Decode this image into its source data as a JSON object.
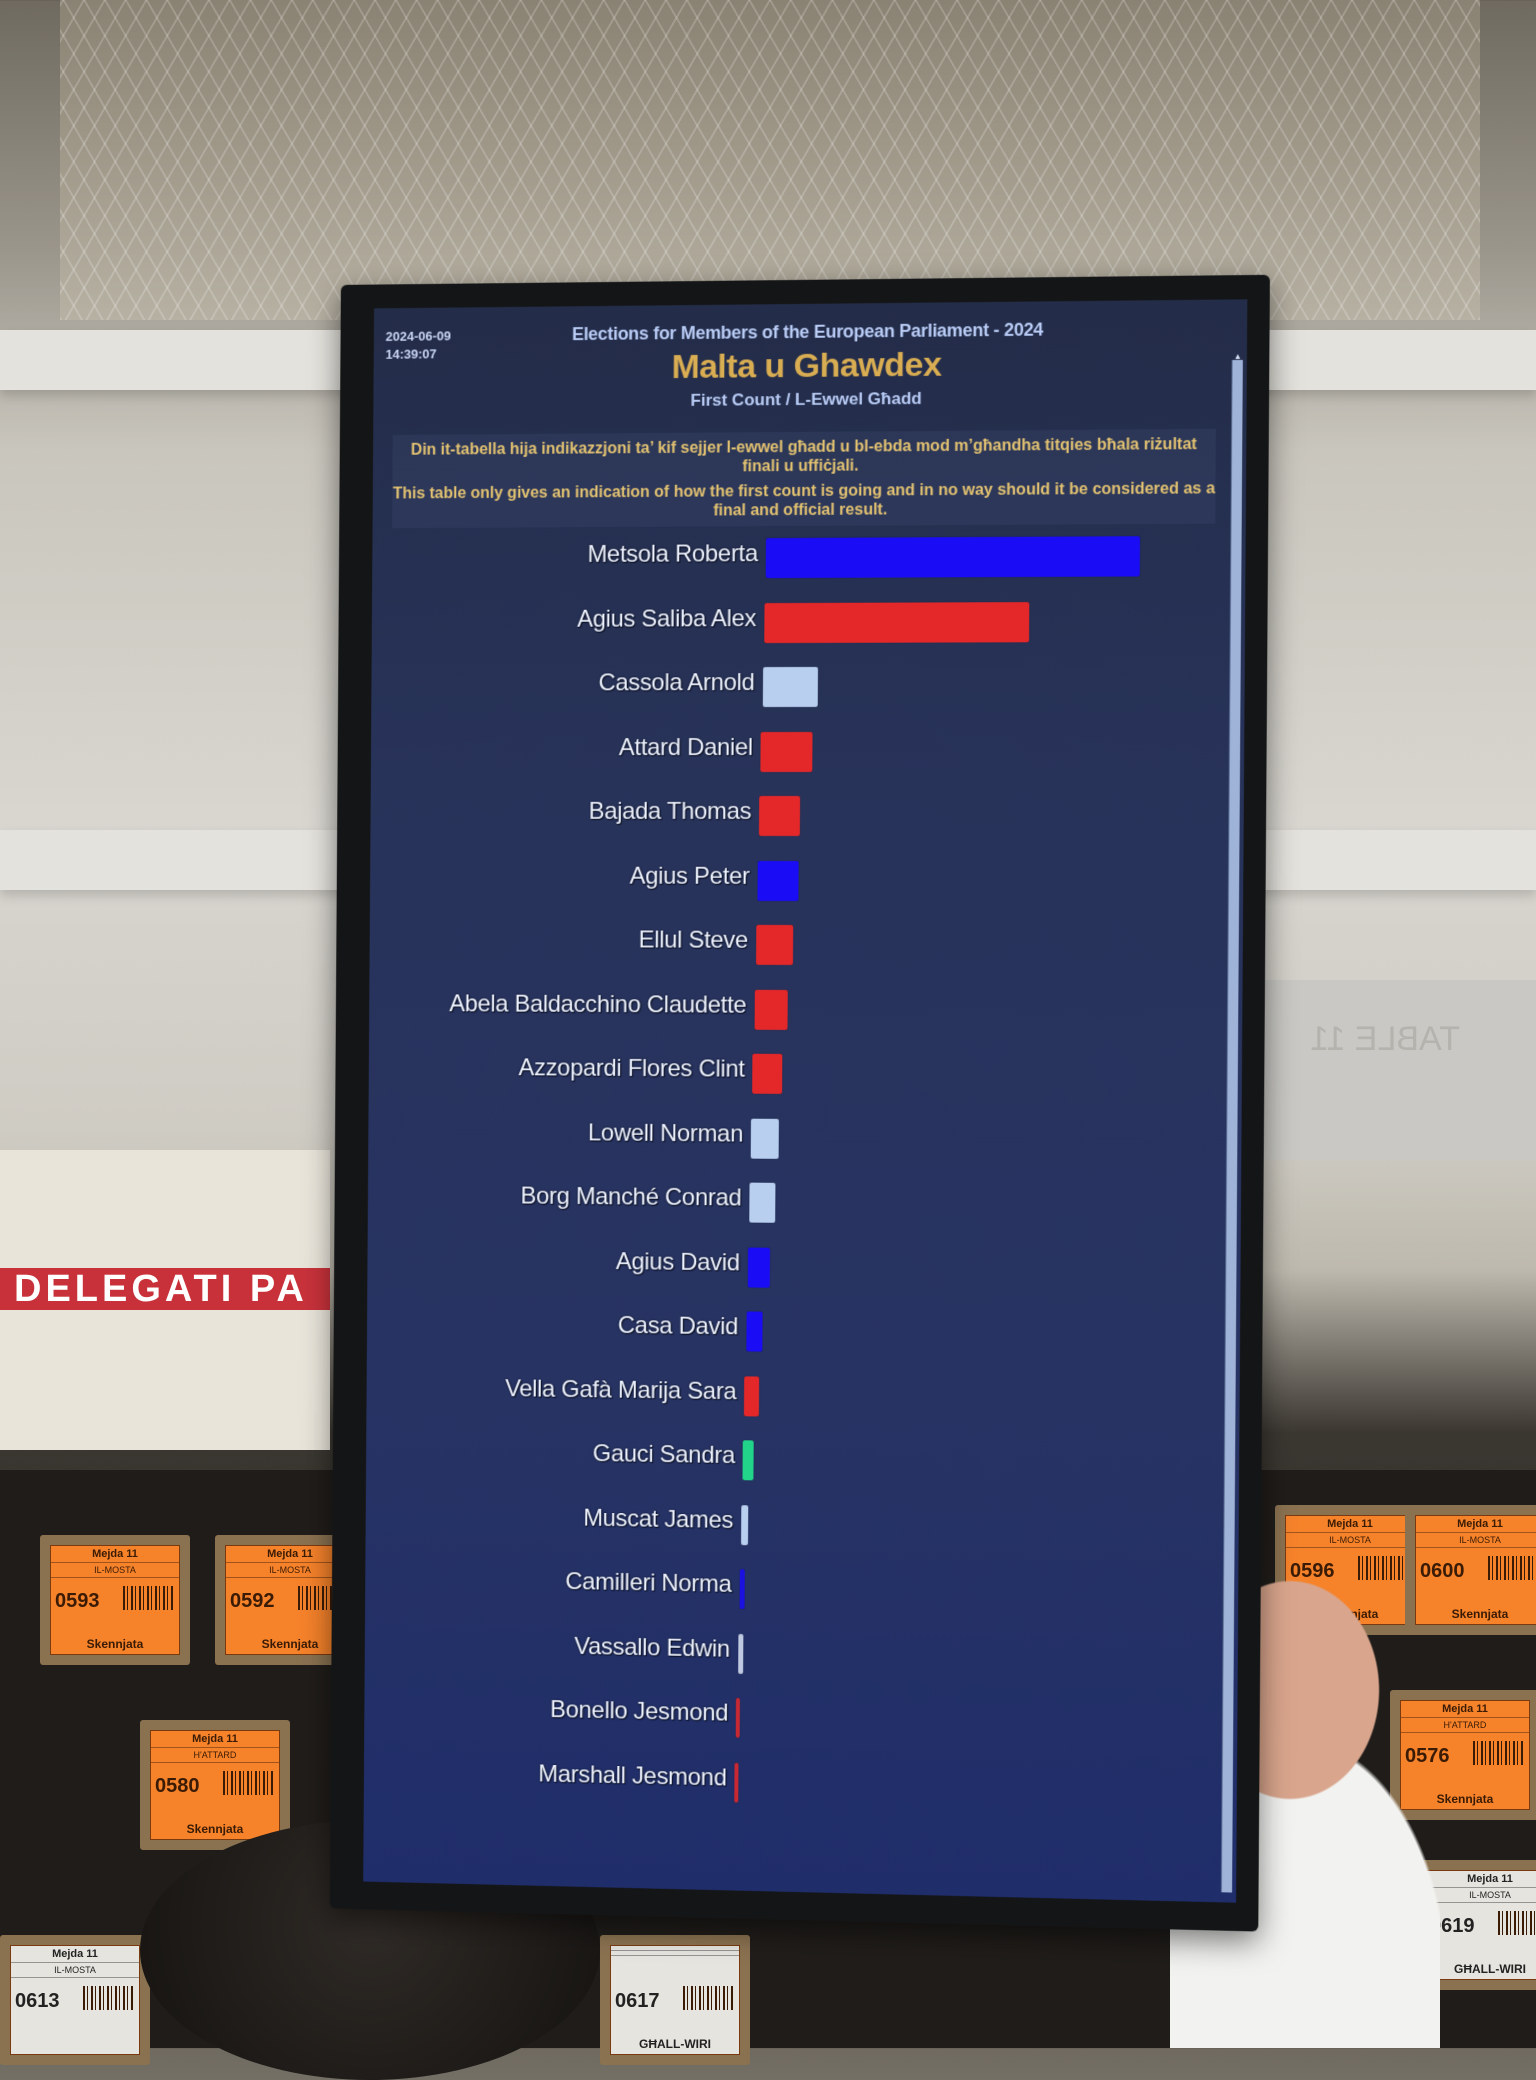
{
  "screen": {
    "date": "2024-06-09",
    "time": "14:39:07",
    "election_title": "Elections for Members of the European Parliament - 2024",
    "region_title": "Malta u Ghawdex",
    "count_title": "First Count / L-Ewwel Għadd",
    "disclaimer_mt": "Din it-tabella hija indikazzjoni ta’ kif sejjer l-ewwel għadd u bl-ebda mod m’għandha titqies bħala riżultat finali u uffiċjali.",
    "disclaimer_en": "This table only gives an indication of how the first count is going and in no way should it be considered as a final and official result."
  },
  "colors": {
    "pn_blue": "#1a0cf5",
    "pl_red": "#e4282a",
    "independent_lightblue": "#b8cff0",
    "green": "#22d48a",
    "region_gold": "#d9ad52",
    "disclaimer_gold": "#e2c271"
  },
  "chart_data": {
    "type": "bar",
    "orientation": "horizontal",
    "title": "Malta u Ghawdex — First Count / L-Ewwel Għadd",
    "xlabel": "",
    "ylabel": "",
    "value_unit": "relative share of leading candidate (no numeric axis shown; estimated from bar lengths)",
    "xlim": [
      0,
      1
    ],
    "grid": false,
    "categories": [
      "Metsola Roberta",
      "Agius Saliba Alex",
      "Cassola Arnold",
      "Attard Daniel",
      "Bajada Thomas",
      "Agius Peter",
      "Ellul Steve",
      "Abela Baldacchino Claudette",
      "Azzopardi Flores Clint",
      "Lowell Norman",
      "Borg Manché Conrad",
      "Agius David",
      "Casa David",
      "Vella Gafà Marija Sara",
      "Gauci Sandra",
      "Muscat James",
      "Camilleri Norma",
      "Vassallo Edwin",
      "Bonello Jesmond",
      "Marshall Jesmond"
    ],
    "values": [
      1.0,
      0.71,
      0.15,
      0.14,
      0.11,
      0.11,
      0.1,
      0.09,
      0.08,
      0.075,
      0.07,
      0.06,
      0.045,
      0.04,
      0.03,
      0.02,
      0.015,
      0.015,
      0.01,
      0.01
    ],
    "bar_colors": [
      "#1a0cf5",
      "#e4282a",
      "#b8cff0",
      "#e4282a",
      "#e4282a",
      "#1a0cf5",
      "#e4282a",
      "#e4282a",
      "#e4282a",
      "#b8cff0",
      "#b8cff0",
      "#1a0cf5",
      "#1a0cf5",
      "#e4282a",
      "#22d48a",
      "#b8cff0",
      "#1a0cf5",
      "#dbe6f8",
      "#e4282a",
      "#e4282a"
    ]
  },
  "background": {
    "banner_text": "DELEGATI PA",
    "wall_sign": "TABLE 11",
    "boxes": [
      {
        "table": "Mejda 11",
        "place": "IL-MOSTA",
        "number": "0593",
        "status": "Skennjata",
        "style": "orange"
      },
      {
        "table": "Mejda 11",
        "place": "IL-MOSTA",
        "number": "0592",
        "status": "Skennjata",
        "style": "orange"
      },
      {
        "table": "Mejda 11",
        "place": "H'ATTARD",
        "number": "0580",
        "status": "Skennjata",
        "style": "orange"
      },
      {
        "table": "Mejda 11",
        "place": "IL-MOSTA",
        "number": "0596",
        "status": "Skennjata",
        "style": "orange"
      },
      {
        "table": "Mejda 11",
        "place": "IL-MOSTA",
        "number": "0600",
        "status": "Skennjata",
        "style": "orange"
      },
      {
        "table": "Mejda 11",
        "place": "H'ATTARD",
        "number": "0576",
        "status": "Skennjata",
        "style": "orange"
      },
      {
        "table": "Mejda 11",
        "place": "IL-MOSTA",
        "number": "0613",
        "status": "",
        "style": "white"
      },
      {
        "table": "",
        "place": "",
        "number": "0617",
        "status": "GĦALL-WIRI",
        "style": "white"
      },
      {
        "table": "Mejda 11",
        "place": "IL-MOSTA",
        "number": "0619",
        "status": "GĦALL-WIRI",
        "style": "white"
      }
    ]
  }
}
